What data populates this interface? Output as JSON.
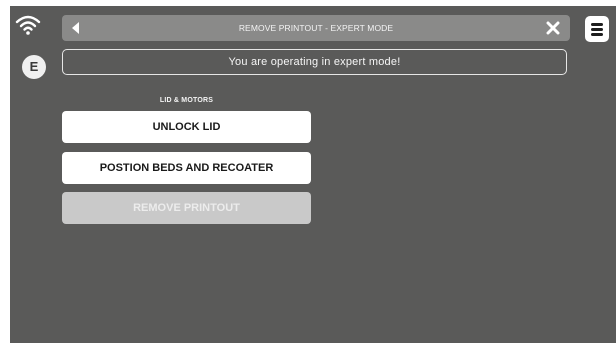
{
  "header": {
    "title": "REMOVE PRINTOUT - EXPERT MODE"
  },
  "status": {
    "mode_badge": "E"
  },
  "banner": {
    "message": "You are operating in expert mode!"
  },
  "section": {
    "label": "LID & MOTORS"
  },
  "actions": {
    "unlock_lid": "UNLOCK LID",
    "position_beds": "POSTION BEDS AND RECOATER",
    "remove_printout": "REMOVE PRINTOUT"
  },
  "colors": {
    "background": "#5a5a59",
    "titlebar": "#8a8a89",
    "button": "#ffffff",
    "button_disabled": "#c9c9c9"
  }
}
